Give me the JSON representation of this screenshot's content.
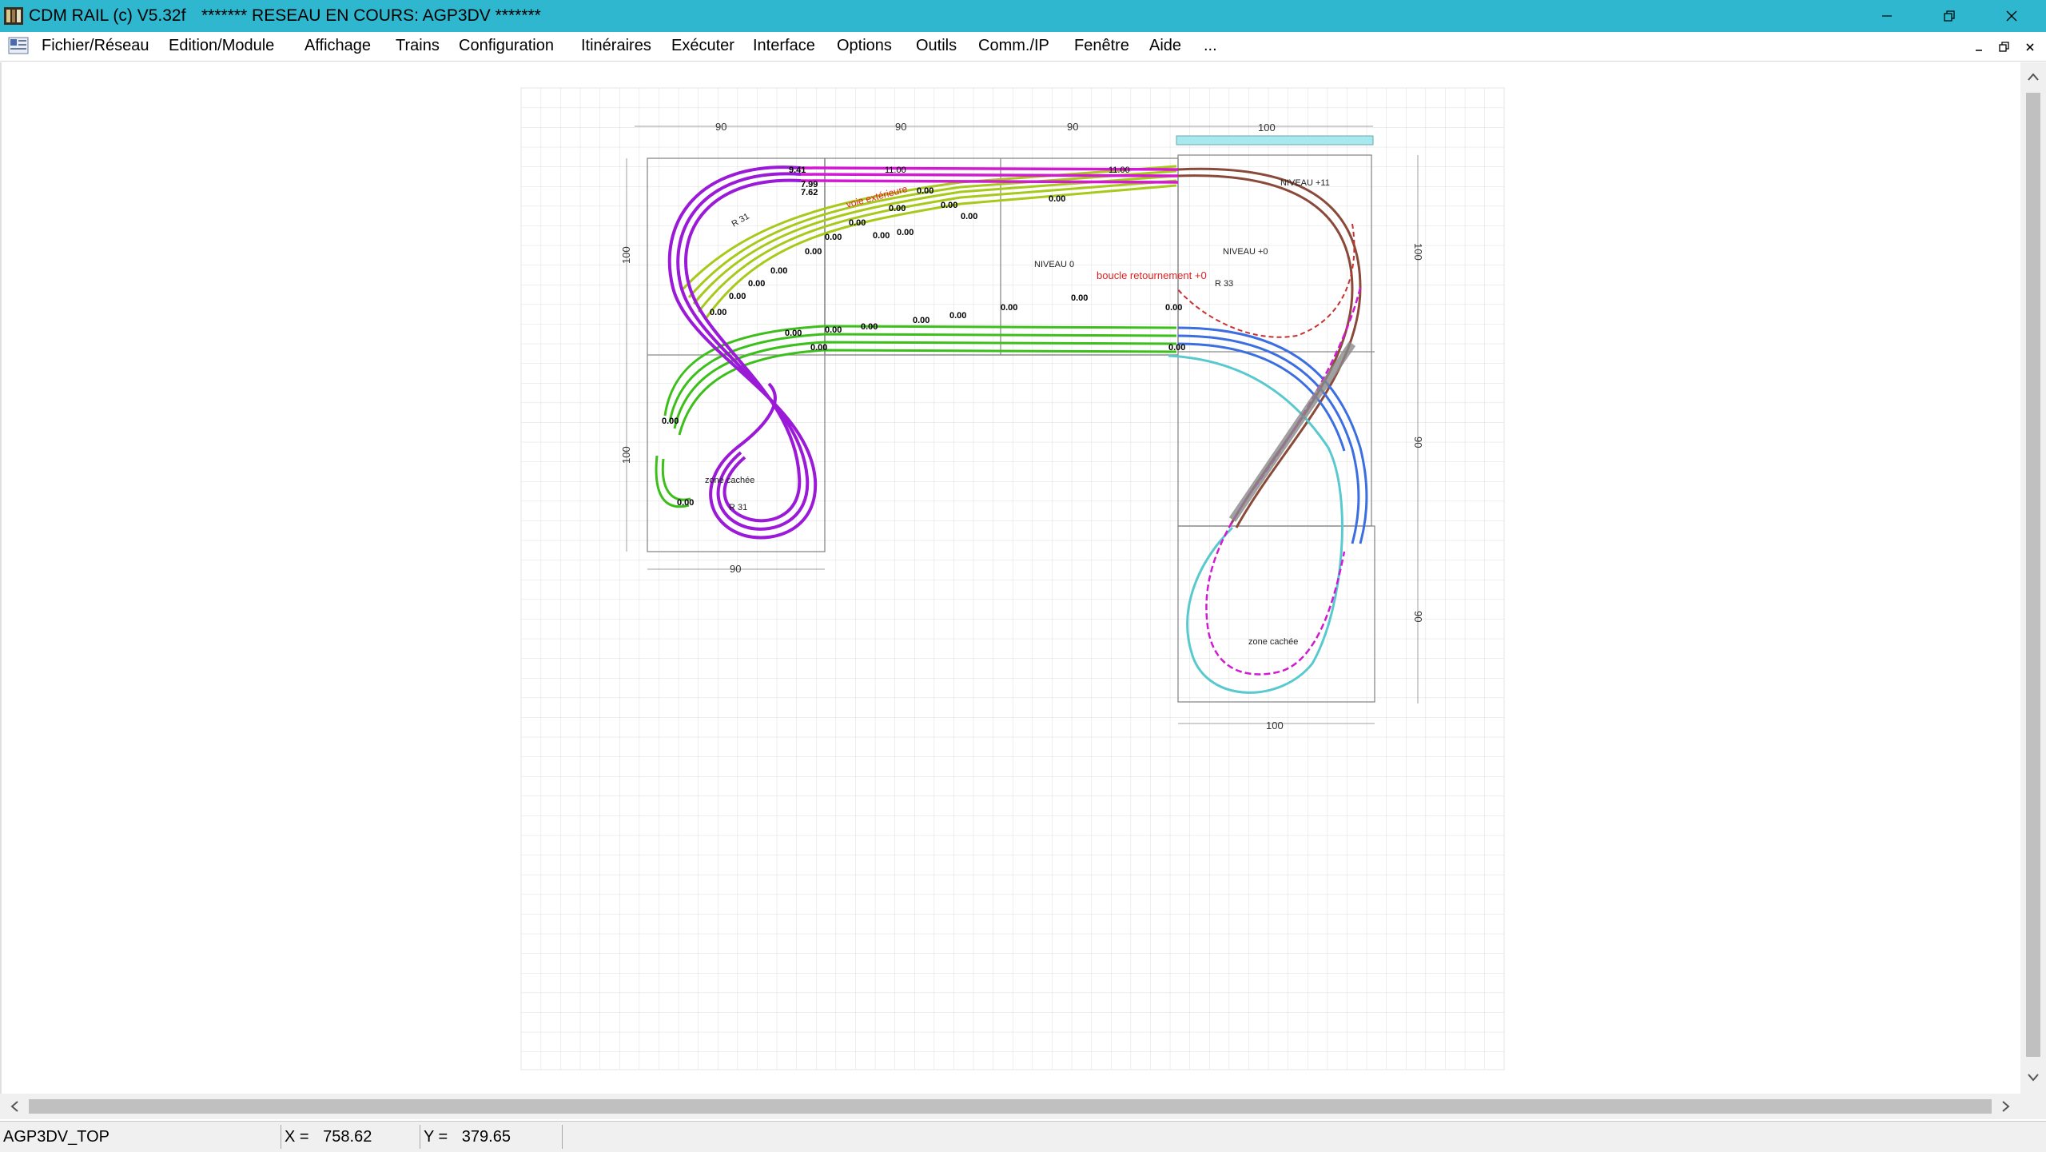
{
  "window": {
    "title": "CDM RAIL (c) V5.32f",
    "subtitle": "******* RESEAU EN COURS: AGP3DV *******",
    "accent_color": "#2eb7cf"
  },
  "menu": {
    "items": [
      "Fichier/Réseau",
      "Edition/Module",
      "Affichage",
      "Trains",
      "Configuration",
      "Itinéraires",
      "Exécuter",
      "Interface",
      "Options",
      "Outils",
      "Comm./IP",
      "Fenêtre",
      "Aide",
      "..."
    ]
  },
  "layout": {
    "dimensions": {
      "top": [
        "90",
        "90",
        "90",
        "100"
      ],
      "left": [
        "100",
        "100"
      ],
      "bottom_left": "90",
      "right": [
        "100",
        "90",
        "90"
      ],
      "bottom_right": "100"
    },
    "labels": {
      "niveau0": "NIVEAU 0",
      "niveau_plus0": "NIVEAU +0",
      "niveau_plus11": "NIVEAU +11",
      "boucle": "boucle retournement +0",
      "voie_exterieure": "voie extérieure",
      "zone_cachee_left": "zone cachée",
      "zone_cachee_right": "zone cachée",
      "r31_left": "R 31",
      "r31_top": "R 31",
      "r33": "R 33"
    },
    "elevations_yellow": [
      "0.00",
      "0.00",
      "0.00",
      "0.00",
      "0.00",
      "0.00",
      "0.00",
      "0.00",
      "0.00",
      "0.00",
      "0.00",
      "0.00",
      "0.00",
      "0.00"
    ],
    "elevations_green": [
      "0.00",
      "0.00",
      "0.00",
      "0.00",
      "0.00",
      "0.00",
      "0.00",
      "0.00",
      "0.00",
      "0.00",
      "0.00",
      "0.00"
    ],
    "elevation_top": [
      "9.41",
      "7.99",
      "7.62",
      "11.00",
      "11.00"
    ],
    "track_colors": {
      "purple": "#9a1ad8",
      "magenta": "#d21ad2",
      "yellow_green": "#a6c91a",
      "green": "#3cbf1a",
      "blue": "#3b6ee0",
      "brown": "#8a4a3a",
      "cyan": "#59c9d0",
      "red_dashed": "#e02020",
      "grey": "#8a8a8a"
    }
  },
  "status": {
    "view": "AGP3DV_TOP",
    "x_label": "X =",
    "x_value": "758.62",
    "y_label": "Y =",
    "y_value": "379.65"
  },
  "icons": {
    "minimize": "minimize-icon",
    "restore": "restore-icon",
    "close": "close-icon",
    "scroll_up": "arrow-up-icon",
    "scroll_down": "arrow-down-icon",
    "scroll_left": "arrow-left-icon",
    "scroll_right": "arrow-right-icon"
  }
}
